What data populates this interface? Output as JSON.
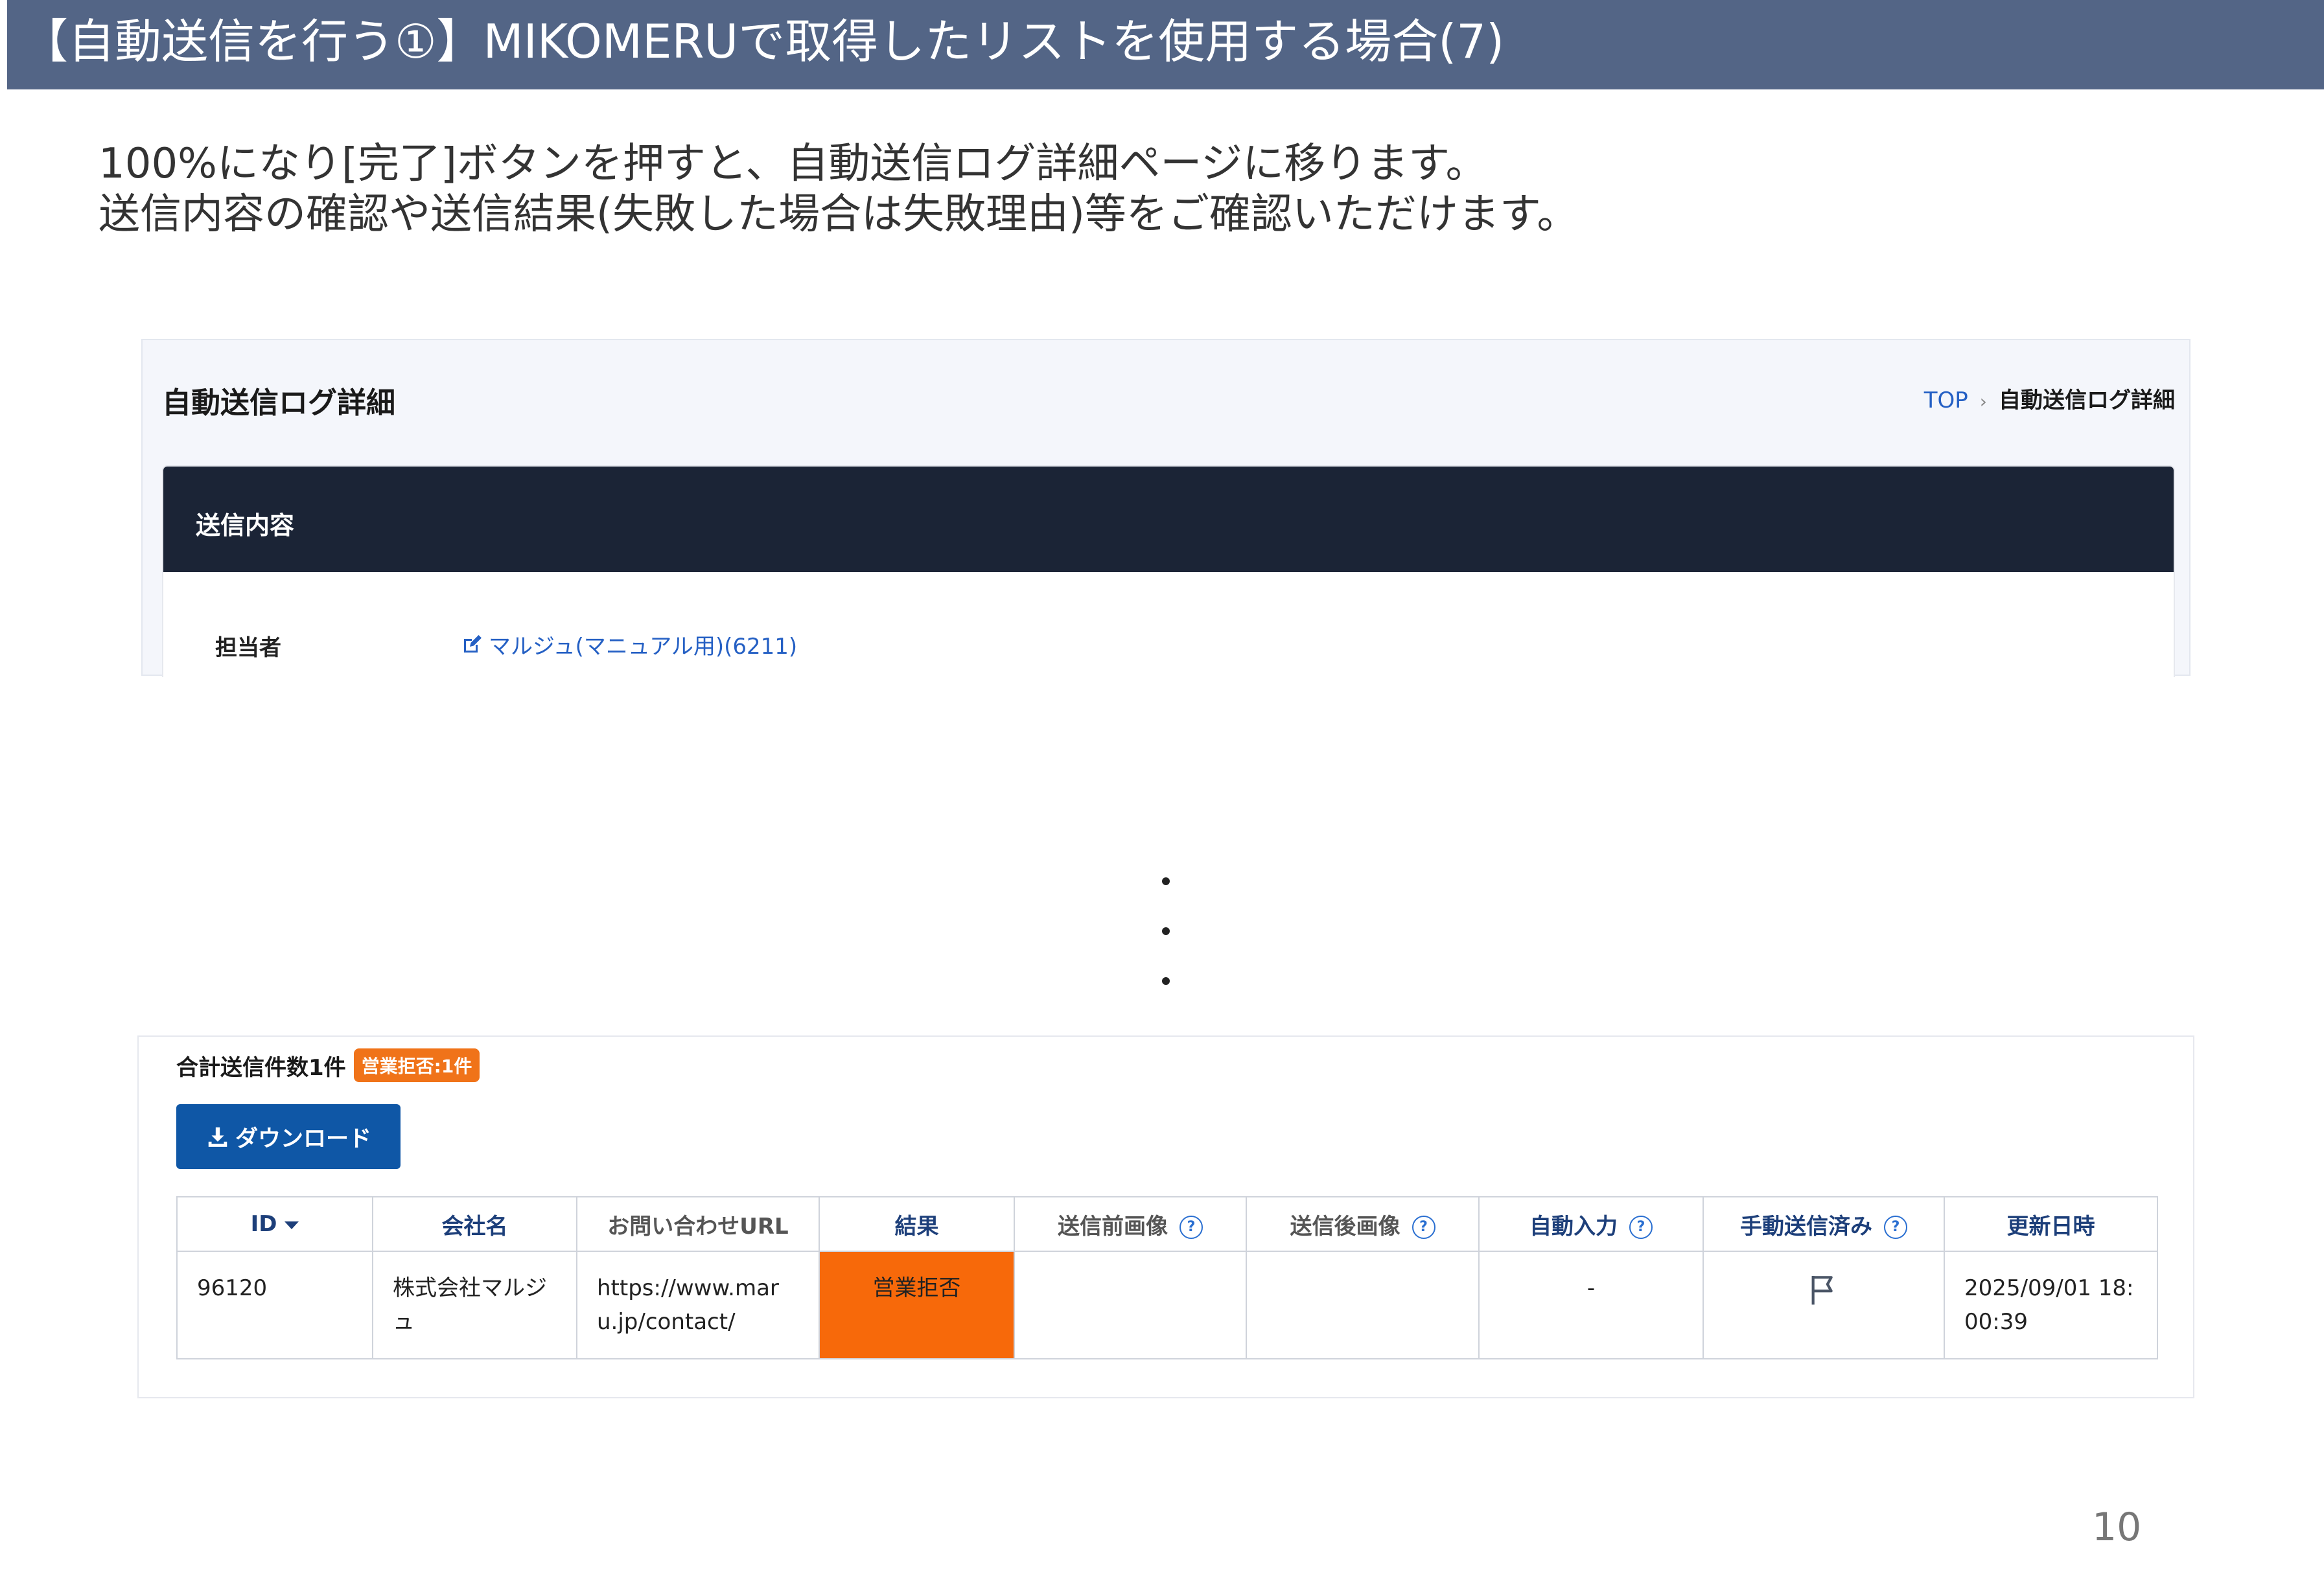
{
  "slide": {
    "title": "【自動送信を行う①】MIKOMERUで取得したリストを使用する場合(7)",
    "intro_line1": "100%になり[完了]ボタンを押すと、自動送信ログ詳細ページに移ります。",
    "intro_line2": "送信内容の確認や送信結果(失敗した場合は失敗理由)等をご確認いただけます。",
    "page_number": "10"
  },
  "header": {
    "page_title": "自動送信ログ詳細",
    "breadcrumb": {
      "top": "TOP",
      "separator": "›",
      "current": "自動送信ログ詳細"
    }
  },
  "send_content": {
    "section_title": "送信内容",
    "assignee_label": "担当者",
    "assignee_value": "マルジュ(マニュアル用)(6211)"
  },
  "results": {
    "total_label": "合計送信件数1件",
    "refusal_badge": "営業拒否:1件",
    "download_label": "ダウンロード",
    "columns": {
      "id": "ID",
      "company": "会社名",
      "contact_url": "お問い合わせURL",
      "result": "結果",
      "before_image": "送信前画像",
      "after_image": "送信後画像",
      "auto_input": "自動入力",
      "manual_sent": "手動送信済み",
      "updated": "更新日時"
    },
    "rows": [
      {
        "id": "96120",
        "company": "株式会社マルジュ",
        "contact_url": "https://www.maru.jp/contact/",
        "result": "営業拒否",
        "before_image": "",
        "after_image": "",
        "auto_input": "-",
        "manual_sent_icon": "flag-icon",
        "updated": "2025/09/01 18:00:39"
      }
    ]
  },
  "colors": {
    "banner": "#536586",
    "card_header": "#1b2436",
    "link": "#2560c4",
    "badge": "#f07319",
    "result_cell": "#f7690a",
    "download_button": "#0f57a6"
  }
}
